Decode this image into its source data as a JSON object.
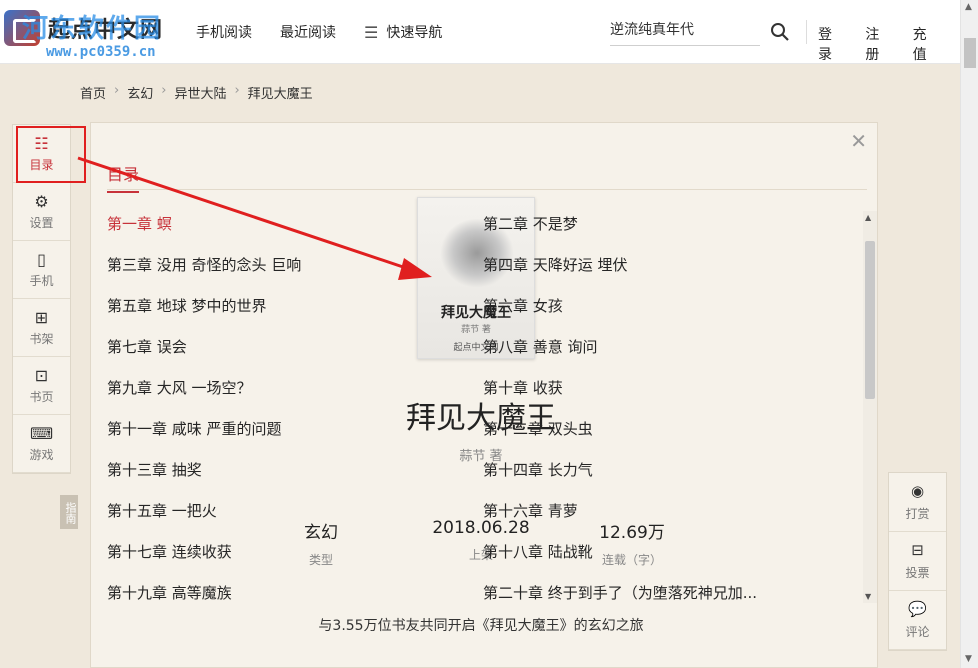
{
  "header": {
    "logo_text": "起点中文网",
    "watermark": "河东软件园",
    "watermark_url": "www.pc0359.cn",
    "nav": [
      "手机阅读",
      "最近阅读",
      "快速导航"
    ],
    "search_value": "逆流纯真年代",
    "links": [
      "登录",
      "注册",
      "充值"
    ]
  },
  "breadcrumb": [
    "首页",
    "玄幻",
    "异世大陆",
    "拜见大魔王"
  ],
  "sidebar": [
    {
      "label": "目录",
      "icon": "list-icon"
    },
    {
      "label": "设置",
      "icon": "gear-icon"
    },
    {
      "label": "手机",
      "icon": "phone-icon"
    },
    {
      "label": "书架",
      "icon": "bookshelf-icon"
    },
    {
      "label": "书页",
      "icon": "bookpage-icon"
    },
    {
      "label": "游戏",
      "icon": "gamepad-icon"
    }
  ],
  "guide_tab": "指南",
  "toc": {
    "title": "目录",
    "chapters": [
      "第一章 螟",
      "第二章 不是梦",
      "第三章 没用 奇怪的念头 巨响",
      "第四章 天降好运 埋伏",
      "第五章 地球 梦中的世界",
      "第六章 女孩",
      "第七章 误会",
      "第八章 善意 询问",
      "第九章 大风 一场空？",
      "第十章 收获",
      "第十一章 咸味 严重的问题",
      "第十二章 双头虫",
      "第十三章 抽奖",
      "第十四章 长力气",
      "第十五章 一把火",
      "第十六章 青萝",
      "第十七章 连续收获",
      "第十八章 陆战靴",
      "第十九章 高等魔族",
      "第二十章 终于到手了（为堕落死神兄加..."
    ]
  },
  "book": {
    "cover_title": "拜见大魔王",
    "cover_author": "蒜节 著",
    "cover_publisher": "起点中文网",
    "name": "拜见大魔王",
    "author": "蒜节 著",
    "stats": [
      {
        "value": "玄幻",
        "key": "类型"
      },
      {
        "value": "2018.06.28",
        "key": "上架"
      },
      {
        "value": "12.69万",
        "key": "连载（字）"
      }
    ],
    "readers": "与3.55万位书友共同开启《拜见大魔王》的玄幻之旅"
  },
  "right_sidebar": [
    {
      "label": "打赏",
      "icon": "reward-icon"
    },
    {
      "label": "投票",
      "icon": "vote-icon"
    },
    {
      "label": "评论",
      "icon": "comment-icon"
    }
  ],
  "colors": {
    "accent": "#c7323a",
    "annotation": "#e01f1f",
    "background": "#efe8dc"
  }
}
